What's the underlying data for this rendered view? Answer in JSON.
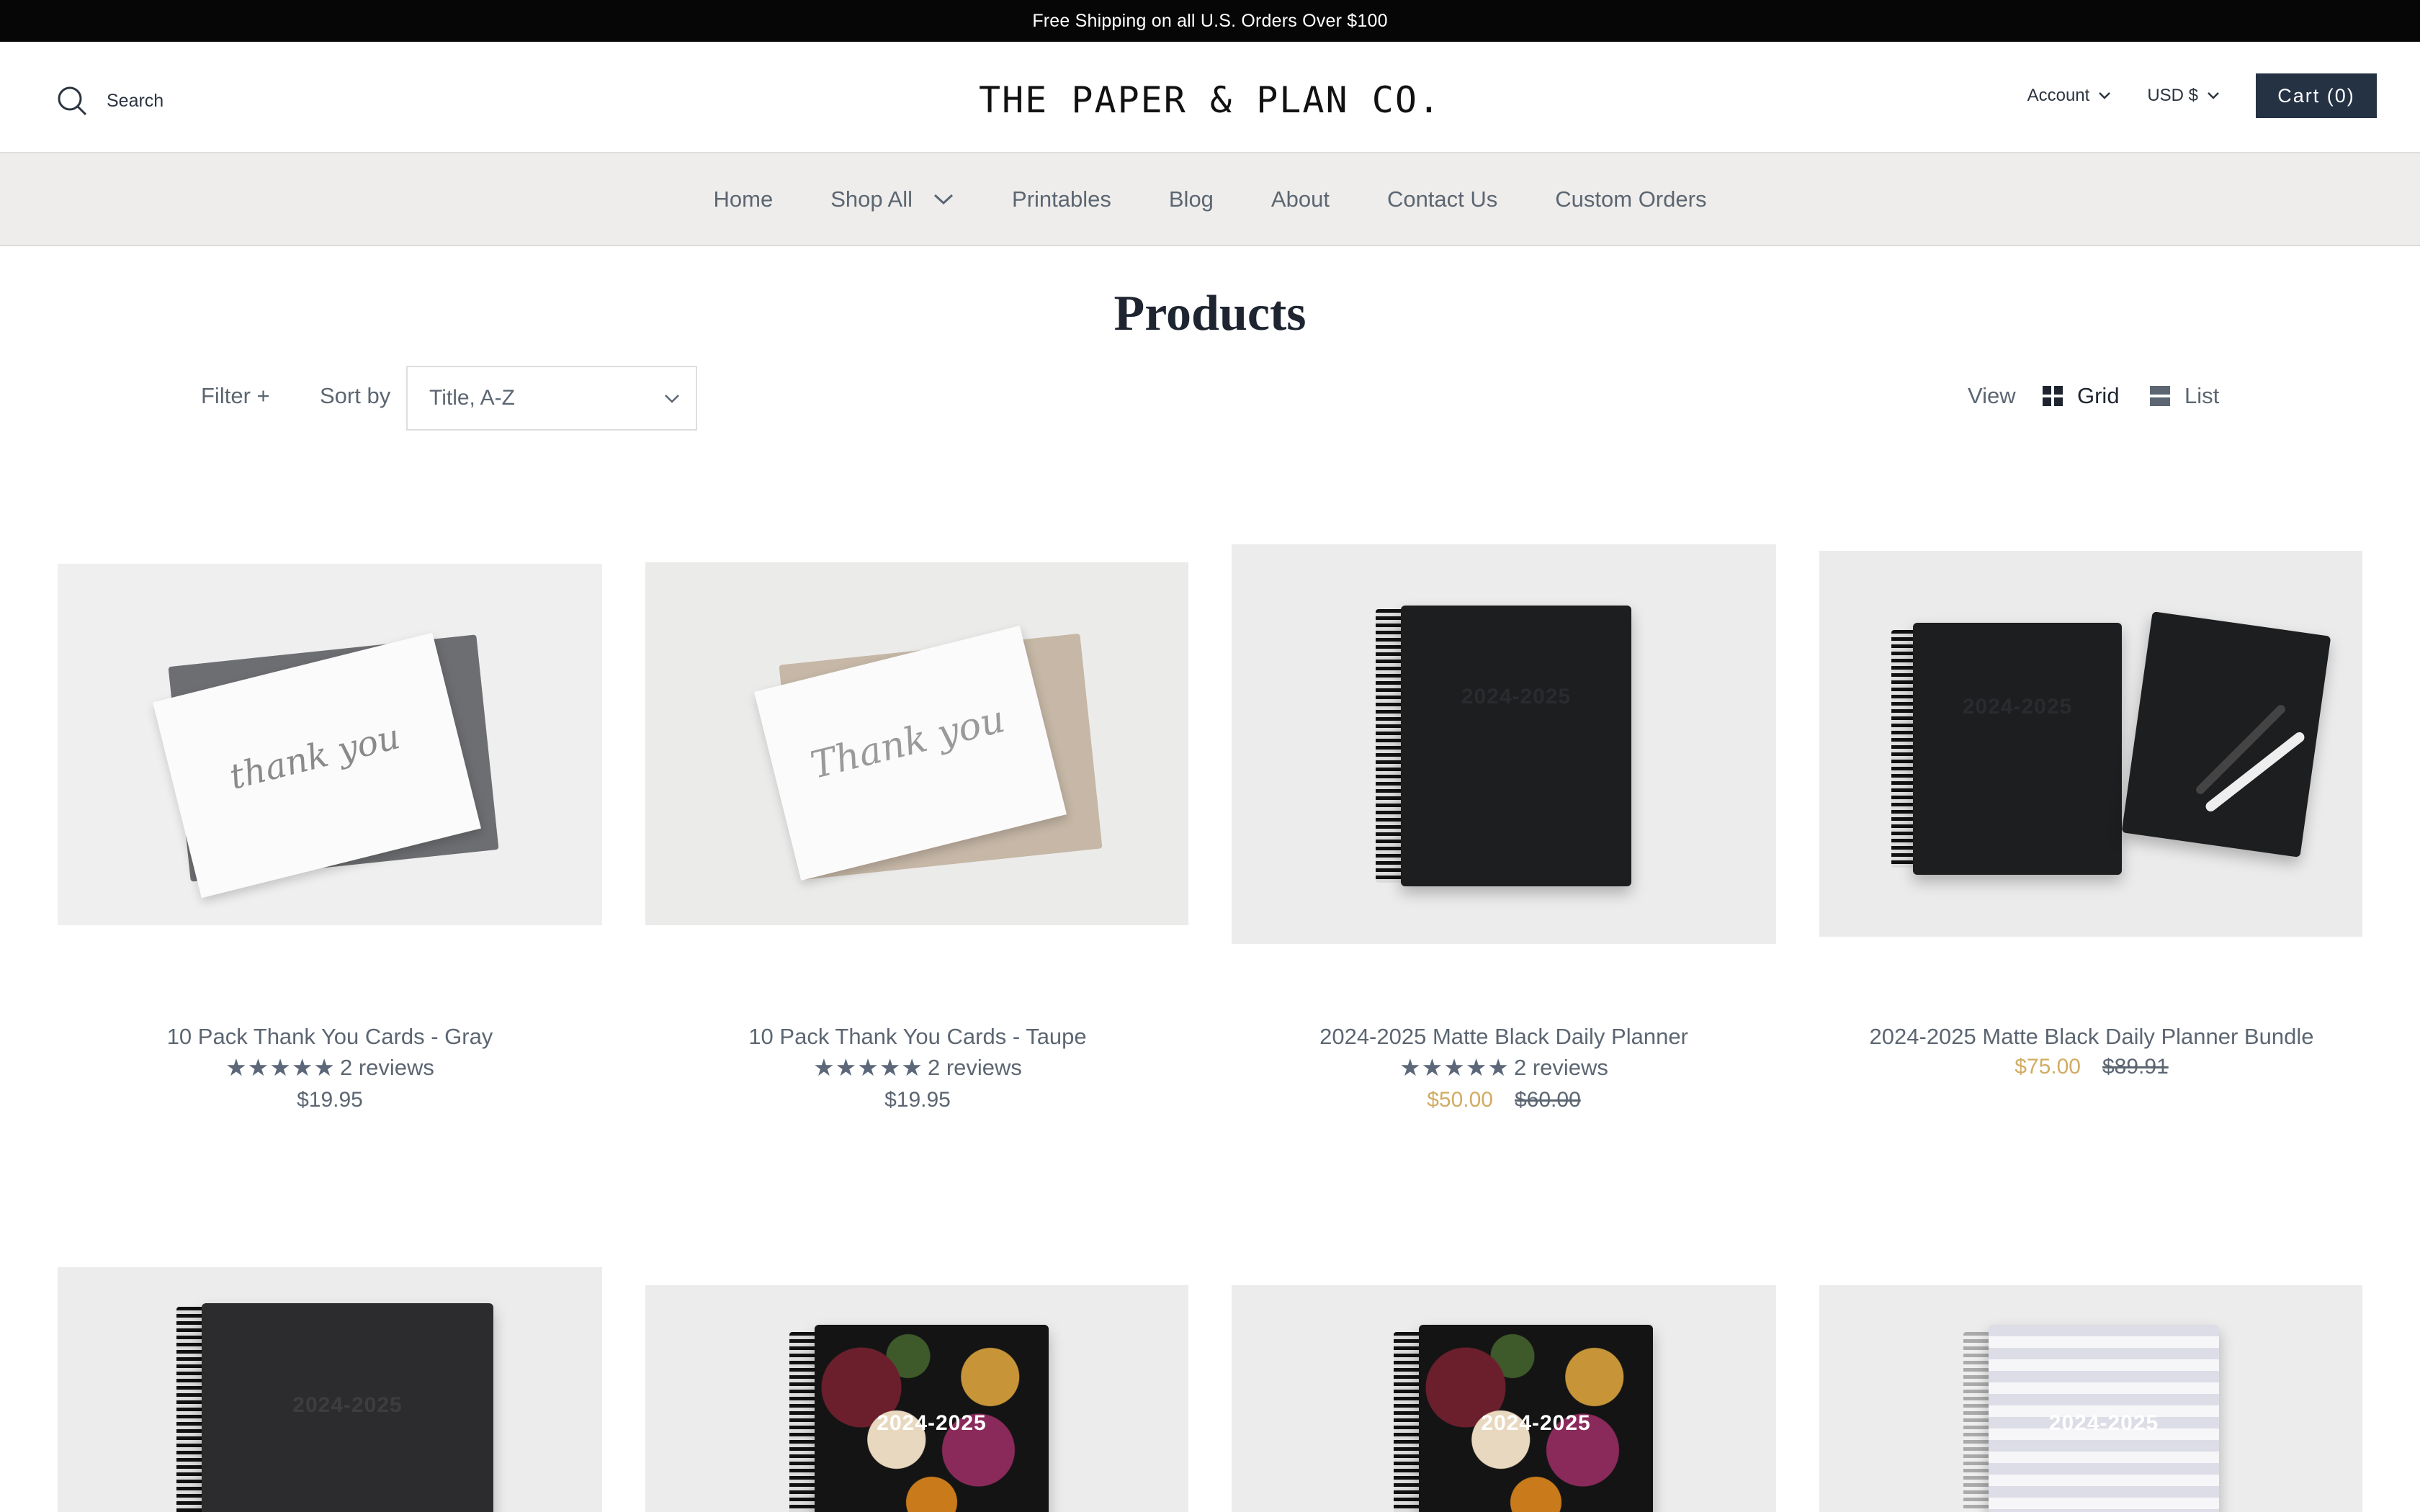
{
  "announcement": "Free Shipping on all U.S. Orders Over $100",
  "header": {
    "search_label": "Search",
    "logo": "THE PAPER & PLAN CO.",
    "account_label": "Account",
    "currency_label": "USD $",
    "cart_label": "Cart (0)"
  },
  "nav": {
    "items": [
      {
        "label": "Home"
      },
      {
        "label": "Shop All"
      },
      {
        "label": "Printables"
      },
      {
        "label": "Blog"
      },
      {
        "label": "About"
      },
      {
        "label": "Contact Us"
      },
      {
        "label": "Custom Orders"
      }
    ]
  },
  "page": {
    "title": "Products",
    "filter_label": "Filter +",
    "sort_label": "Sort by",
    "sort_value": "Title, A-Z",
    "view_label": "View",
    "view_grid": "Grid",
    "view_list": "List"
  },
  "products": [
    {
      "title": "10 Pack Thank You Cards - Gray",
      "stars": "★★★★★",
      "reviews": "2 reviews",
      "price": "$19.95",
      "envelope_color": "#6d6e71",
      "card_script": "thank you"
    },
    {
      "title": "10 Pack Thank You Cards - Taupe",
      "stars": "★★★★★",
      "reviews": "2 reviews",
      "price": "$19.95",
      "envelope_color": "#c6b7a6",
      "card_script": "Thank you"
    },
    {
      "title": "2024-2025 Matte Black Daily Planner",
      "stars": "★★★★★",
      "reviews": "2 reviews",
      "sale_price": "$50.00",
      "compare_price": "$60.00",
      "cover_text": "2024-2025"
    },
    {
      "title": "2024-2025 Matte Black Daily Planner Bundle",
      "sale_price": "$75.00",
      "compare_price": "$89.91",
      "cover_text": "2024-2025"
    },
    {
      "cover_text": "2024-2025"
    },
    {
      "cover_text": "2024-2025"
    },
    {
      "cover_text": "2024-2025"
    },
    {
      "cover_text": "2024-2025"
    }
  ],
  "colors": {
    "announcement_bg": "#060606",
    "cart_button": "#253244",
    "nav_bg": "#eeedeb",
    "sale_price": "#d1ac63",
    "text": "#5c6672"
  }
}
